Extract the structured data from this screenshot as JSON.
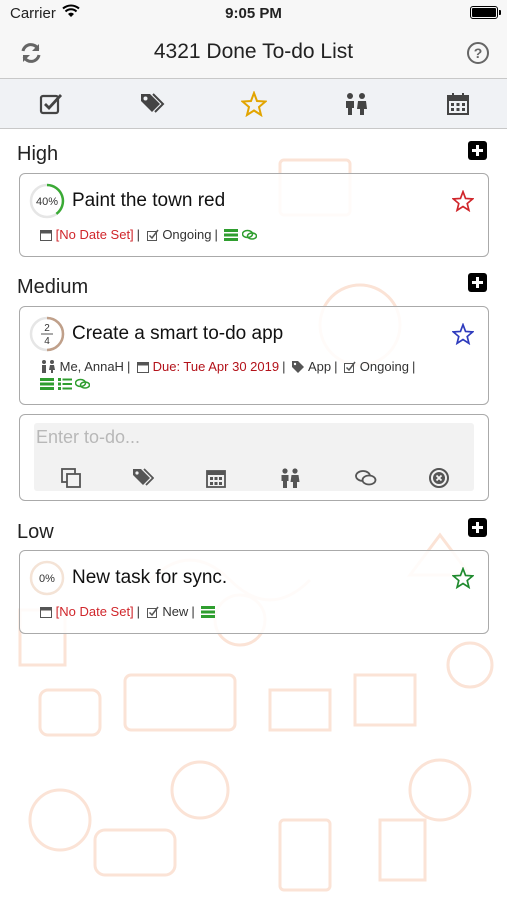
{
  "status": {
    "carrier": "Carrier",
    "time": "9:05 PM"
  },
  "header": {
    "title": "4321 Done To-do List",
    "help_label": "?"
  },
  "tabs": [
    {
      "icon": "checkbox-icon"
    },
    {
      "icon": "tags-icon"
    },
    {
      "icon": "star-icon",
      "active": true,
      "color": "#e2a400"
    },
    {
      "icon": "people-icon"
    },
    {
      "icon": "calendar-icon"
    }
  ],
  "sections": {
    "high": {
      "label": "High",
      "task": {
        "progress": "40%",
        "progress_value": 0.4,
        "title": "Paint the town red",
        "date": "[No Date Set]",
        "status": "Ongoing",
        "star_color": "#d0262b"
      }
    },
    "medium": {
      "label": "Medium",
      "task": {
        "progress_num": "2",
        "progress_den": "4",
        "progress_value": 0.5,
        "title": "Create a smart to-do app",
        "people": "Me, AnnaH",
        "date": "Due: Tue Apr 30 2019",
        "tag": "App",
        "status": "Ongoing",
        "star_color": "#2e3bbd"
      },
      "entry": {
        "placeholder": "Enter to-do..."
      }
    },
    "low": {
      "label": "Low",
      "task": {
        "progress": "0%",
        "progress_value": 0,
        "title": "New task for sync.",
        "date": "[No Date Set]",
        "status": "New",
        "star_color": "#1f8a2e"
      }
    }
  },
  "colors": {
    "green_icon": "#2f9e2f",
    "accent": "#e2a400"
  }
}
